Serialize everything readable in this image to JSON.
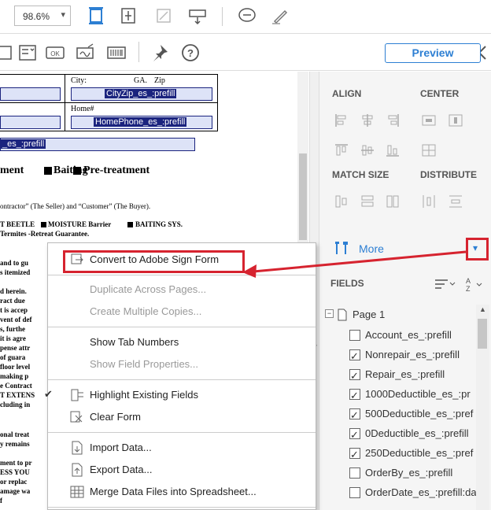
{
  "toolbar": {
    "zoom_value": "98.6%",
    "preview_label": "Preview"
  },
  "document": {
    "city_label": "City:",
    "state_label": "GA.",
    "zip_label": "Zip",
    "city_field": "CityZip_es_:prefill",
    "home_label": "Home#",
    "home_field": "HomePhone_es_:prefill",
    "prefill_field": "_es_:prefill",
    "heading_1": "ment",
    "heading_2": "Baiting",
    "heading_3": "Pre-treatment",
    "line1": "ontractor” (The Seller) and “Customer” (The Buyer).",
    "line2": "T BEETLE",
    "line2b": "MOISTURE Barrier",
    "line2c": "BAITING SYS.",
    "line3": "Termites -Retreat Guarantee.",
    "line4": "and to gu",
    "line5": "s itemized",
    "line6": "d herein.",
    "line7": "ract due",
    "line8": "t is accep",
    "line9": "vent of def",
    "line10": "s, furthe",
    "line11": "it is agre",
    "line12": "pense attr",
    "line13": "of guara",
    "line14": "floor level",
    "line15": "making p",
    "line16": "e Contract",
    "line17": "T EXTENS",
    "line18": "cluding in",
    "line19": "onal treat",
    "line20": "y remains",
    "line21": "ment to pr",
    "line22": "ESS YOU",
    "line23": "or replac",
    "line24": "amage wa",
    "line25": "f"
  },
  "panel": {
    "align_title": "ALIGN",
    "center_title": "CENTER",
    "match_size_title": "MATCH SIZE",
    "distribute_title": "DISTRIBUTE",
    "more_label": "More",
    "fields_title": "FIELDS",
    "page_label": "Page 1",
    "fields": [
      {
        "name": "Account_es_:prefill",
        "icon": "text-field-icon"
      },
      {
        "name": "Nonrepair_es_:prefill",
        "icon": "checkbox-icon"
      },
      {
        "name": "Repair_es_:prefill",
        "icon": "checkbox-icon"
      },
      {
        "name": "1000Deductible_es_:pr",
        "icon": "checkbox-icon"
      },
      {
        "name": "500Deductible_es_:pref",
        "icon": "checkbox-icon"
      },
      {
        "name": "0Deductible_es_:prefill",
        "icon": "checkbox-icon"
      },
      {
        "name": "250Deductible_es_:pref",
        "icon": "checkbox-icon"
      },
      {
        "name": "OrderBy_es_:prefill",
        "icon": "text-field-icon"
      },
      {
        "name": "OrderDate_es_:prefill:da",
        "icon": "date-field-icon"
      }
    ]
  },
  "menu": {
    "items": [
      {
        "label": "Convert to Adobe Sign Form",
        "enabled": true
      },
      {
        "label": "Duplicate Across Pages...",
        "enabled": false
      },
      {
        "label": "Create Multiple Copies...",
        "enabled": false
      },
      {
        "label": "Show Tab Numbers",
        "enabled": true
      },
      {
        "label": "Show Field Properties...",
        "enabled": false
      },
      {
        "label": "Highlight Existing Fields",
        "enabled": true,
        "checked": true
      },
      {
        "label": "Clear Form",
        "enabled": true
      },
      {
        "label": "Import Data...",
        "enabled": true
      },
      {
        "label": "Export Data...",
        "enabled": true
      },
      {
        "label": "Merge Data Files into Spreadsheet...",
        "enabled": true
      }
    ]
  },
  "colors": {
    "accent": "#2d7fd3",
    "annotation_red": "#d6232f",
    "field_fill": "#dde3f7",
    "field_border": "#1a237e"
  }
}
